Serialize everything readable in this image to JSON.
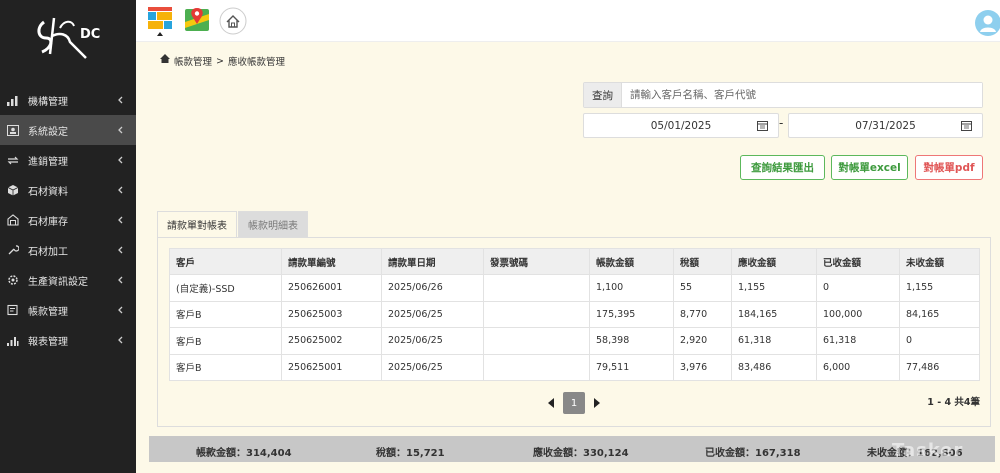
{
  "logo": {
    "text": "DC"
  },
  "sidebar": {
    "items": [
      {
        "label": "機構管理",
        "icon": "bar-chart-icon"
      },
      {
        "label": "系統設定",
        "icon": "id-card-icon",
        "active": true
      },
      {
        "label": "進銷管理",
        "icon": "exchange-icon"
      },
      {
        "label": "石材資料",
        "icon": "cube-icon"
      },
      {
        "label": "石材庫存",
        "icon": "warehouse-icon"
      },
      {
        "label": "石材加工",
        "icon": "tools-icon"
      },
      {
        "label": "生產資訊設定",
        "icon": "gear-icon"
      },
      {
        "label": "帳款管理",
        "icon": "ledger-icon"
      },
      {
        "label": "報表管理",
        "icon": "report-icon"
      }
    ]
  },
  "breadcrumb": {
    "parent": "帳款管理",
    "separator": ">",
    "current": "應收帳款管理"
  },
  "search": {
    "label": "查詢",
    "placeholder": "請輸入客戶名稱、客戶代號",
    "value": ""
  },
  "dates": {
    "start": "05/01/2025",
    "end": "07/31/2025",
    "separator": "-"
  },
  "buttons": {
    "export_results": "查詢結果匯出",
    "statement_excel": "對帳單excel",
    "statement_pdf": "對帳單pdf"
  },
  "tabs": [
    {
      "label": "請款單對帳表",
      "active": true
    },
    {
      "label": "帳款明細表",
      "active": false
    }
  ],
  "table": {
    "headers": [
      "客戶",
      "請款單編號",
      "請款單日期",
      "發票號碼",
      "帳款金額",
      "稅額",
      "應收金額",
      "已收金額",
      "未收金額"
    ],
    "rows": [
      [
        "(自定義)-SSD",
        "250626001",
        "2025/06/26",
        "",
        "1,100",
        "55",
        "1,155",
        "0",
        "1,155"
      ],
      [
        "客戶B",
        "250625003",
        "2025/06/25",
        "",
        "175,395",
        "8,770",
        "184,165",
        "100,000",
        "84,165"
      ],
      [
        "客戶B",
        "250625002",
        "2025/06/25",
        "",
        "58,398",
        "2,920",
        "61,318",
        "61,318",
        "0"
      ],
      [
        "客戶B",
        "250625001",
        "2025/06/25",
        "",
        "79,511",
        "3,976",
        "83,486",
        "6,000",
        "77,486"
      ]
    ]
  },
  "pagination": {
    "current": "1",
    "info": "1 - 4 共4筆"
  },
  "summary": {
    "amount": "帳款金額：314,404",
    "tax": "稅額：15,721",
    "receivable": "應收金額：330,124",
    "received": "已收金額：167,318",
    "unreceived": "未收金額：162,806"
  },
  "watermark": "Tasker",
  "colors": {
    "sidebar": "#222222",
    "background": "#fdf9e8",
    "green": "#5cb85c",
    "red": "#e05555"
  }
}
